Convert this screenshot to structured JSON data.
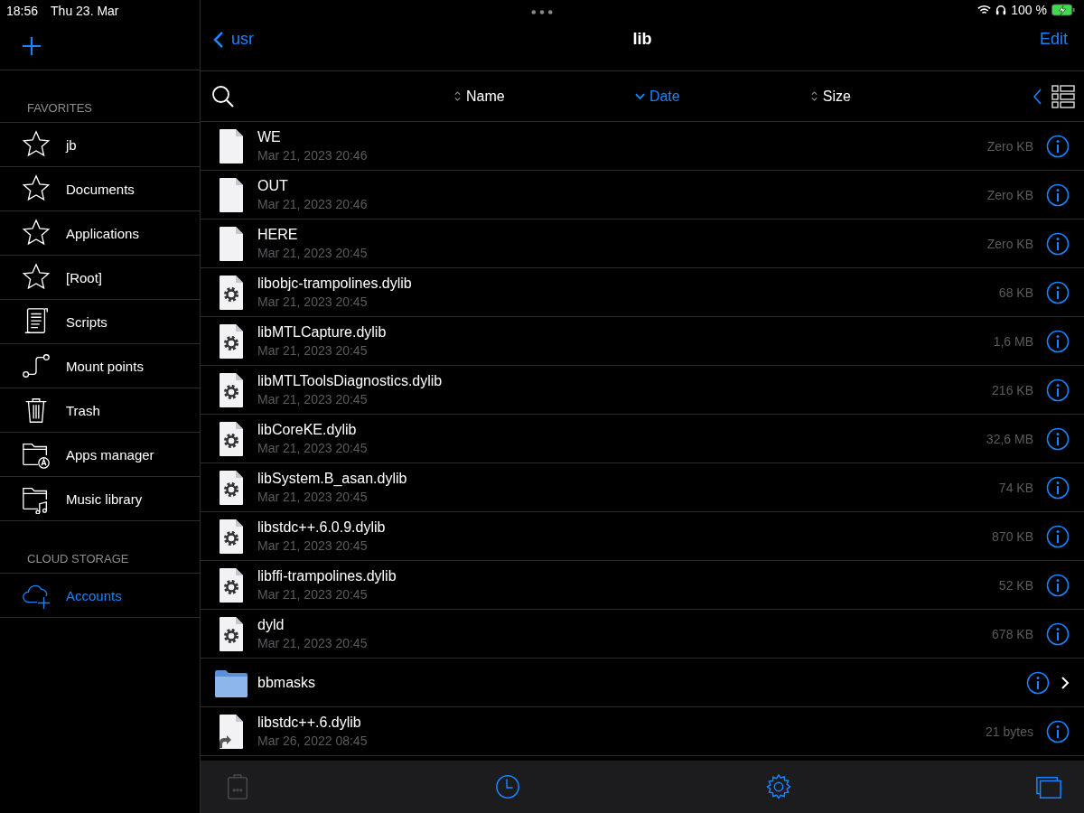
{
  "status_bar": {
    "time": "18:56",
    "date": "Thu 23. Mar",
    "battery": "100 %"
  },
  "sidebar": {
    "sections": [
      {
        "title": "FAVORITES",
        "items": [
          {
            "label": "jb",
            "kind": "star"
          },
          {
            "label": "Documents",
            "kind": "star"
          },
          {
            "label": "Applications",
            "kind": "star"
          },
          {
            "label": "[Root]",
            "kind": "star"
          },
          {
            "label": "Scripts",
            "kind": "scroll"
          },
          {
            "label": "Mount points",
            "kind": "mount"
          },
          {
            "label": "Trash",
            "kind": "trash"
          },
          {
            "label": "Apps manager",
            "kind": "apps"
          },
          {
            "label": "Music library",
            "kind": "music"
          }
        ]
      },
      {
        "title": "CLOUD STORAGE",
        "items": [
          {
            "label": "Accounts",
            "kind": "cloud"
          }
        ]
      }
    ]
  },
  "nav": {
    "back": "usr",
    "title": "lib",
    "action": "Edit"
  },
  "sort_columns": [
    {
      "label": "Name",
      "selected": false
    },
    {
      "label": "Date",
      "selected": true
    },
    {
      "label": "Size",
      "selected": false
    }
  ],
  "files": [
    {
      "name": "WE",
      "date": "Mar 21, 2023 20:46",
      "size": "Zero KB",
      "kind": "file"
    },
    {
      "name": "OUT",
      "date": "Mar 21, 2023 20:46",
      "size": "Zero KB",
      "kind": "file"
    },
    {
      "name": "HERE",
      "date": "Mar 21, 2023 20:45",
      "size": "Zero KB",
      "kind": "file"
    },
    {
      "name": "libobjc-trampolines.dylib",
      "date": "Mar 21, 2023 20:45",
      "size": "68 KB",
      "kind": "dylib"
    },
    {
      "name": "libMTLCapture.dylib",
      "date": "Mar 21, 2023 20:45",
      "size": "1,6 MB",
      "kind": "dylib"
    },
    {
      "name": "libMTLToolsDiagnostics.dylib",
      "date": "Mar 21, 2023 20:45",
      "size": "216 KB",
      "kind": "dylib"
    },
    {
      "name": "libCoreKE.dylib",
      "date": "Mar 21, 2023 20:45",
      "size": "32,6 MB",
      "kind": "dylib"
    },
    {
      "name": "libSystem.B_asan.dylib",
      "date": "Mar 21, 2023 20:45",
      "size": "74 KB",
      "kind": "dylib"
    },
    {
      "name": "libstdc++.6.0.9.dylib",
      "date": "Mar 21, 2023 20:45",
      "size": "870 KB",
      "kind": "dylib"
    },
    {
      "name": "libffi-trampolines.dylib",
      "date": "Mar 21, 2023 20:45",
      "size": "52 KB",
      "kind": "dylib"
    },
    {
      "name": "dyld",
      "date": "Mar 21, 2023 20:45",
      "size": "678 KB",
      "kind": "dylib"
    },
    {
      "name": "bbmasks",
      "kind": "folder"
    },
    {
      "name": "libstdc++.6.dylib",
      "date": "Mar 26, 2022 08:45",
      "size": "21 bytes",
      "kind": "link"
    }
  ],
  "toolbar": [
    {
      "kind": "clipboard",
      "disabled": true
    },
    {
      "kind": "clock",
      "disabled": false
    },
    {
      "kind": "gear",
      "disabled": false
    },
    {
      "kind": "windows",
      "disabled": false
    }
  ]
}
